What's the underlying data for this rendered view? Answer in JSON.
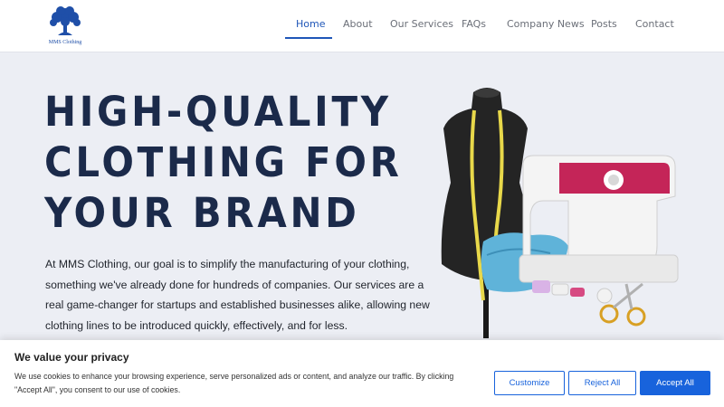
{
  "header": {
    "logo_text": "MMS Clothing",
    "nav": [
      {
        "label": "Home",
        "active": true
      },
      {
        "label": "About",
        "active": false
      },
      {
        "label": "Our Services",
        "active": false
      },
      {
        "label": "FAQs",
        "active": false
      },
      {
        "label": "Company News",
        "active": false
      },
      {
        "label": "Posts",
        "active": false
      },
      {
        "label": "Contact",
        "active": false
      }
    ]
  },
  "hero": {
    "title_lines": [
      "HIGH-QUALITY",
      "CLOTHING FOR",
      "YOUR BRAND"
    ],
    "description": "At MMS Clothing, our goal is to simplify the manufacturing of your clothing, something we've already done for hundreds of companies. Our services are a real game-changer for startups and established businesses alike, allowing new clothing lines to be introduced quickly, effectively, and for less.",
    "image": "mannequin-sewing-machine-image"
  },
  "cookie_banner": {
    "title": "We value your privacy",
    "text": "We use cookies to enhance your browsing experience, serve personalized ads or content, and analyze our traffic. By clicking \"Accept All\", you consent to our use of cookies.",
    "customize_label": "Customize",
    "reject_label": "Reject All",
    "accept_label": "Accept All"
  },
  "colors": {
    "accent": "#1f56b8",
    "title": "#1b2a4a",
    "background": "#eceef4",
    "button": "#1863dc"
  }
}
